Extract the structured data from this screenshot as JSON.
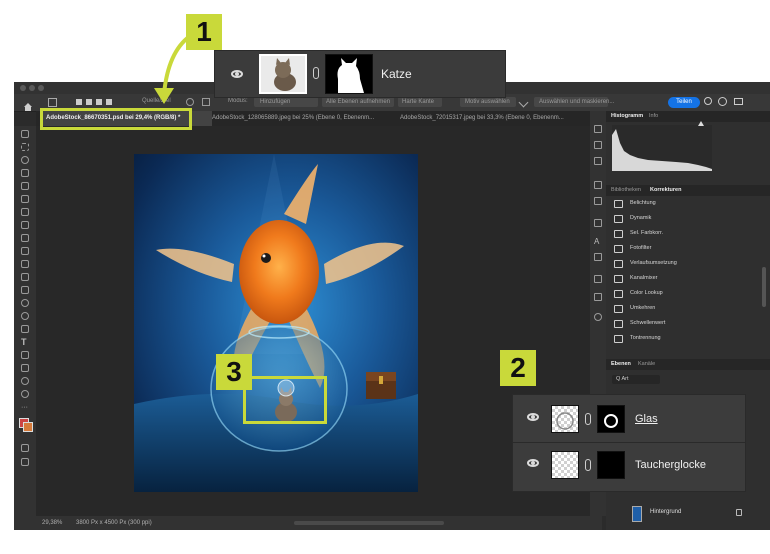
{
  "callouts": {
    "one": "1",
    "two": "2",
    "three": "3"
  },
  "layer_popup": {
    "name": "Katze"
  },
  "options_bar": {
    "items": [
      "Quelle/Ziel",
      "Modus:",
      "Hinzufügen",
      "Alle Ebenen aufnehmen",
      "Harte Kante",
      "Motiv auswählen",
      "Auswählen und maskieren..."
    ],
    "share": "Teilen"
  },
  "tabs": [
    "AdobeStock_86670351.psd bei 29,4% (RGB/8) *",
    "AdobeStock_128065889.jpeg bei 25% (Ebene 0, Ebenenm...",
    "AdobeStock_72015317.jpeg bei 33,3% (Ebene 0, Ebenenm..."
  ],
  "status": {
    "zoom": "29,38%",
    "size": "3800 Px x 4500 Px (300 ppi)"
  },
  "histogram_panel": {
    "tabs": [
      "Histogramm",
      "Info"
    ]
  },
  "adjustments_panel": {
    "tabs": [
      "Bibliotheken",
      "Korrekturen"
    ],
    "items": [
      "Belichtung",
      "Dynamik",
      "Sel. Farbkorr.",
      "Fotofilter",
      "Verlaufsumsetzung",
      "Kanalmixer",
      "Color Lookup",
      "Umkehren",
      "Schwellenwert",
      "Tontrennung"
    ]
  },
  "layers_panel": {
    "tabs": [
      "Ebenen",
      "Kanäle"
    ],
    "filter": "Q Art",
    "zoom_layers": [
      "Glas",
      "Taucherglocke"
    ],
    "background": "Hintergrund"
  },
  "colors": {
    "callout": "#c9d93a",
    "accent": "#1473e6"
  }
}
